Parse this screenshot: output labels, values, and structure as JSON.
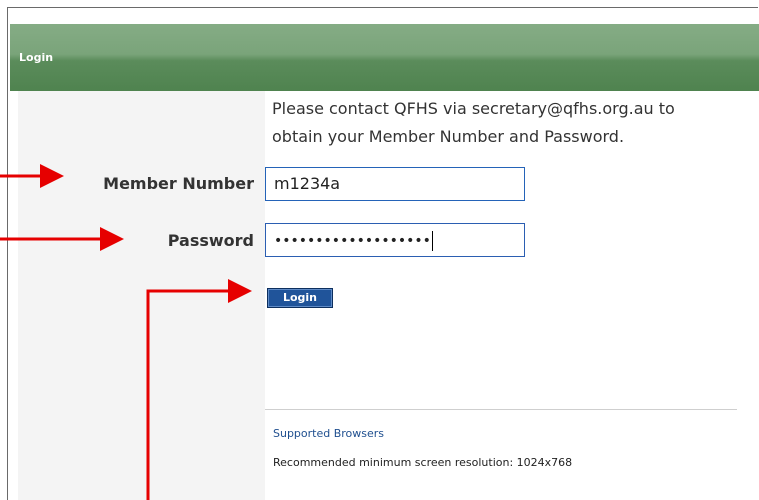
{
  "header": {
    "title": "Login"
  },
  "info_text_line1": "Please contact QFHS via secretary@qfhs.org.au to",
  "info_text_line2": "obtain your Member Number and Password.",
  "form": {
    "member_label": "Member Number",
    "member_value": "m1234a",
    "password_label": "Password",
    "password_masked": "•••••••••••••••••••",
    "login_label": "Login"
  },
  "footer": {
    "supported_browsers": "Supported Browsers",
    "resolution_text": "Recommended minimum screen resolution: 1024x768"
  },
  "colors": {
    "header_green": "#5b8c5b",
    "button_blue": "#20549a",
    "annotation_arrow": "#e60000"
  },
  "icons": [
    "arrow-annotation"
  ]
}
